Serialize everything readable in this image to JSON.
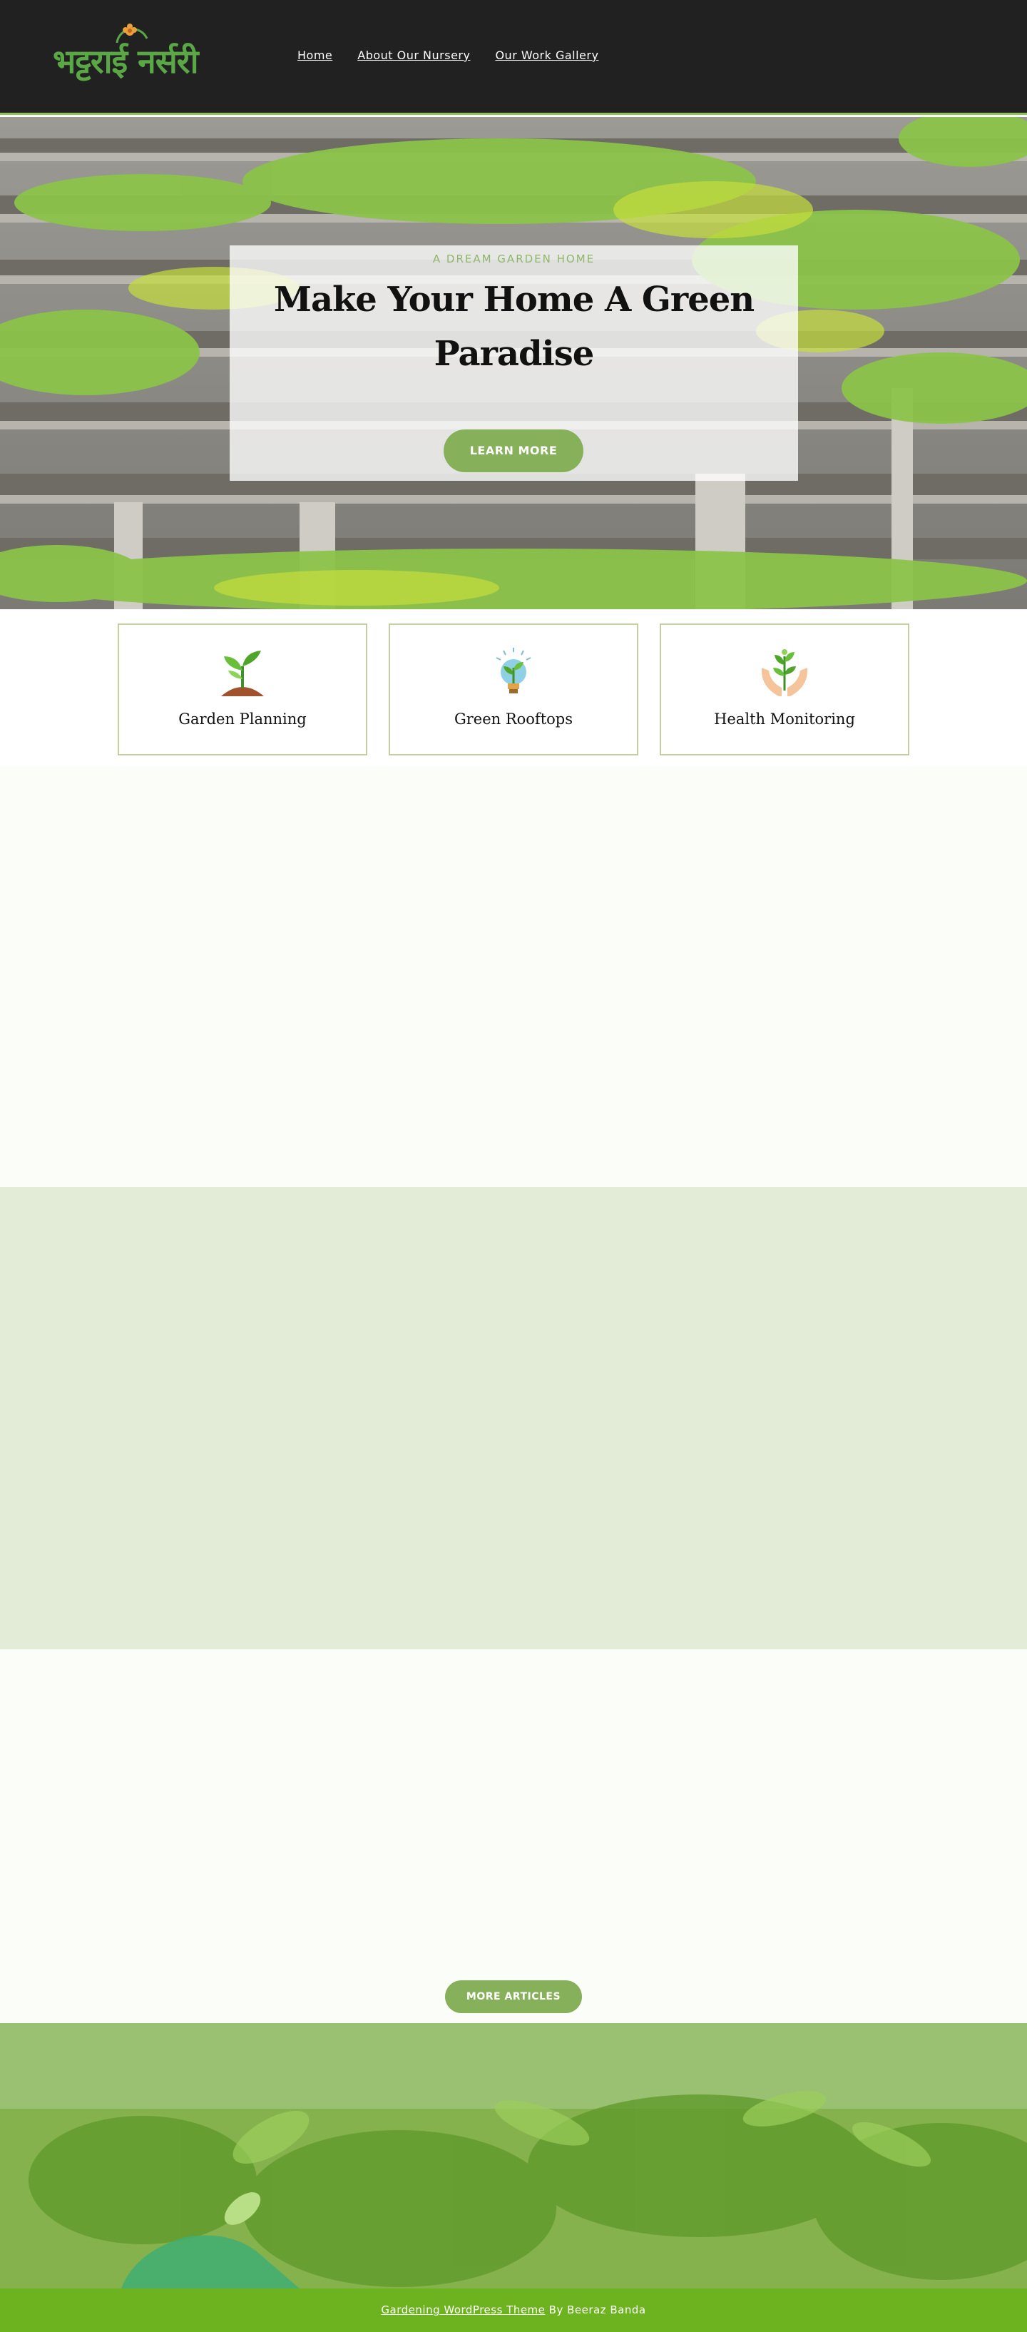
{
  "header": {
    "logo_text": "भट्टराई नर्सरी",
    "nav": [
      {
        "label": "Home"
      },
      {
        "label": "About Our Nursery"
      },
      {
        "label": "Our Work Gallery"
      }
    ]
  },
  "hero": {
    "subtitle": "A DREAM GARDEN HOME",
    "title": "Make Your Home A Green Paradise",
    "button_label": "LEARN MORE"
  },
  "features": [
    {
      "label": "Garden Planning",
      "icon": "sprout-icon"
    },
    {
      "label": "Green Rooftops",
      "icon": "lightbulb-plant-icon"
    },
    {
      "label": "Health Monitoring",
      "icon": "hands-plant-icon"
    }
  ],
  "articles": {
    "more_label": "MORE ARTICLES"
  },
  "footer": {
    "link_text": "Gardening WordPress Theme",
    "by_text": " By Beeraz Banda"
  },
  "colors": {
    "header_bg": "#212121",
    "accent": "#87b05b",
    "footer_bar": "#6db31f",
    "light_band": "#e3ecd6"
  }
}
